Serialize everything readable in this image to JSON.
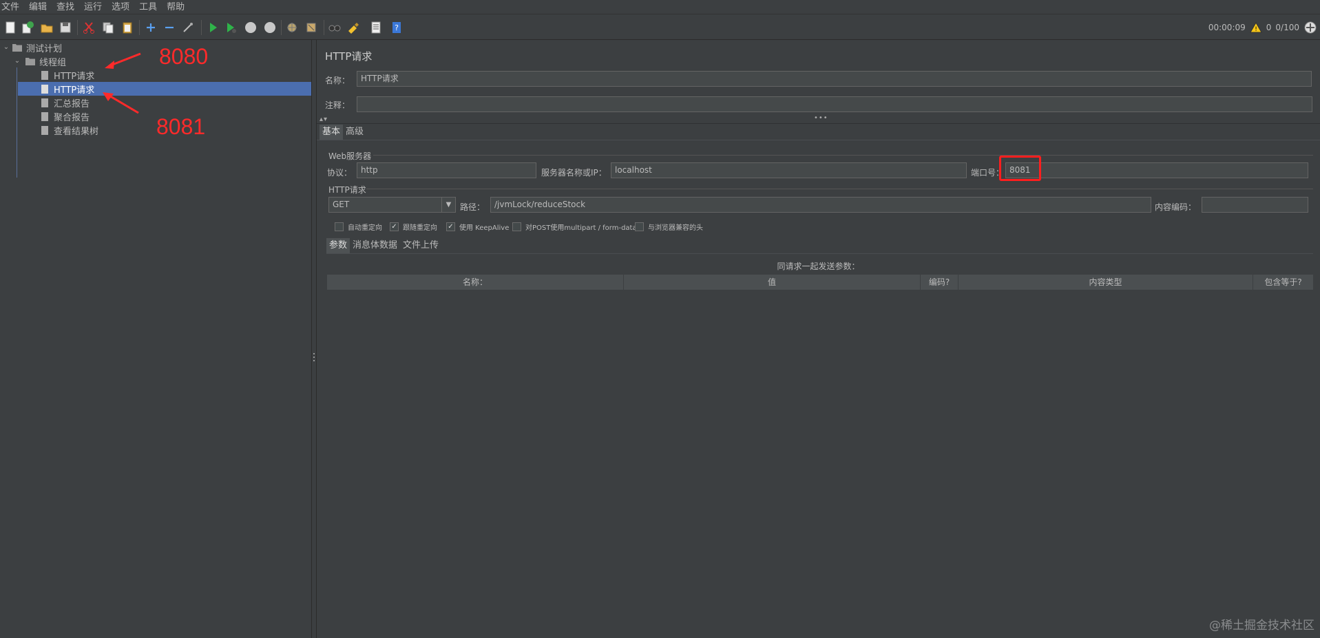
{
  "menu": [
    "文件",
    "编辑",
    "查找",
    "运行",
    "选项",
    "工具",
    "帮助"
  ],
  "toolbar": {
    "timer": "00:00:09",
    "warning_count": "0",
    "threads": "0/100"
  },
  "tree": {
    "root": "测试计划",
    "thread_group": "线程组",
    "items": [
      "HTTP请求",
      "HTTP请求",
      "汇总报告",
      "聚合报告",
      "查看结果树"
    ]
  },
  "annotations": {
    "port_a": "8080",
    "port_b": "8081"
  },
  "panel": {
    "title": "HTTP请求",
    "name_label": "名称：",
    "name_value": "HTTP请求",
    "comment_label": "注释：",
    "comment_value": "",
    "tabs": [
      "基本",
      "高级"
    ],
    "web_server_group": "Web服务器",
    "protocol_label": "协议：",
    "protocol_value": "http",
    "server_label": "服务器名称或IP：",
    "server_value": "localhost",
    "port_label": "端口号：",
    "port_value": "8081",
    "http_request_group": "HTTP请求",
    "method_value": "GET",
    "path_label": "路径：",
    "path_value": "/jvmLock/reduceStock",
    "encoding_label": "内容编码：",
    "encoding_value": "",
    "checkboxes": [
      {
        "label": "自动重定向",
        "checked": false
      },
      {
        "label": "跟随重定向",
        "checked": true
      },
      {
        "label": "使用 KeepAlive",
        "checked": true
      },
      {
        "label": "对POST使用multipart / form-data",
        "checked": false
      },
      {
        "label": "与浏览器兼容的头",
        "checked": false
      }
    ],
    "param_tabs": [
      "参数",
      "消息体数据",
      "文件上传"
    ],
    "params_caption": "同请求一起发送参数：",
    "columns": [
      "名称：",
      "值",
      "编码?",
      "内容类型",
      "包含等于?"
    ]
  },
  "watermark": "@稀土掘金技术社区",
  "colors": {
    "background": "#3c3f41",
    "selection": "#4b6eaf",
    "annotation_red": "#ff2a2a"
  }
}
